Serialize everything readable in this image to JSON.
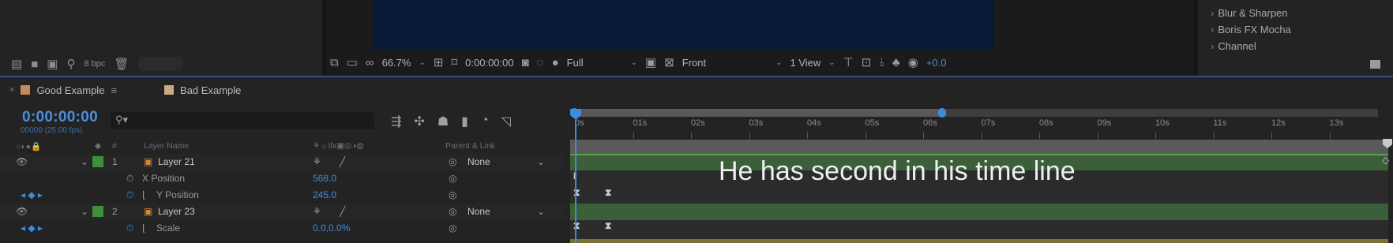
{
  "project_panel": {
    "bpc_label": "8 bpc"
  },
  "comp_toolbar": {
    "zoom": "66.7%",
    "timecode": "0:00:00:00",
    "resolution": "Full",
    "view": "Front",
    "layout": "1 View",
    "exposure": "+0.0"
  },
  "effects": {
    "items": [
      "Blur & Sharpen",
      "Boris FX Mocha",
      "Channel"
    ]
  },
  "tabs": [
    {
      "label": "Good Example",
      "swatch": "#c28b5e"
    },
    {
      "label": "Bad Example",
      "swatch": "#c8aa86"
    }
  ],
  "timeline": {
    "timecode": "0:00:00:00",
    "fps_label": "00000 (25.00 fps)",
    "search_icon": "search-icon",
    "columns": {
      "number": "#",
      "layer_name": "Layer Name",
      "parent_link": "Parent & Link"
    },
    "ruler_ticks": [
      "0s",
      "01s",
      "02s",
      "03s",
      "04s",
      "05s",
      "06s",
      "07s",
      "08s",
      "09s",
      "10s",
      "11s",
      "12s",
      "13s"
    ]
  },
  "layers": {
    "layer21": {
      "number": "1",
      "name": "Layer 21",
      "parent": "None",
      "label_color": "#3e8f3a"
    },
    "x_position": {
      "name": "X Position",
      "value": "568.0"
    },
    "y_position": {
      "name": "Y Position",
      "value": "245.0"
    },
    "layer23": {
      "number": "2",
      "name": "Layer 23",
      "parent": "None",
      "label_color": "#3e8f3a"
    },
    "scale": {
      "name": "Scale",
      "value": "0.0,0.0%"
    }
  },
  "overlay": {
    "caption": "He has second in his time line"
  },
  "colors": {
    "accent_blue": "#3d8cdc",
    "track_green": "#3b5f38",
    "track_yellow": "#7a7236"
  }
}
